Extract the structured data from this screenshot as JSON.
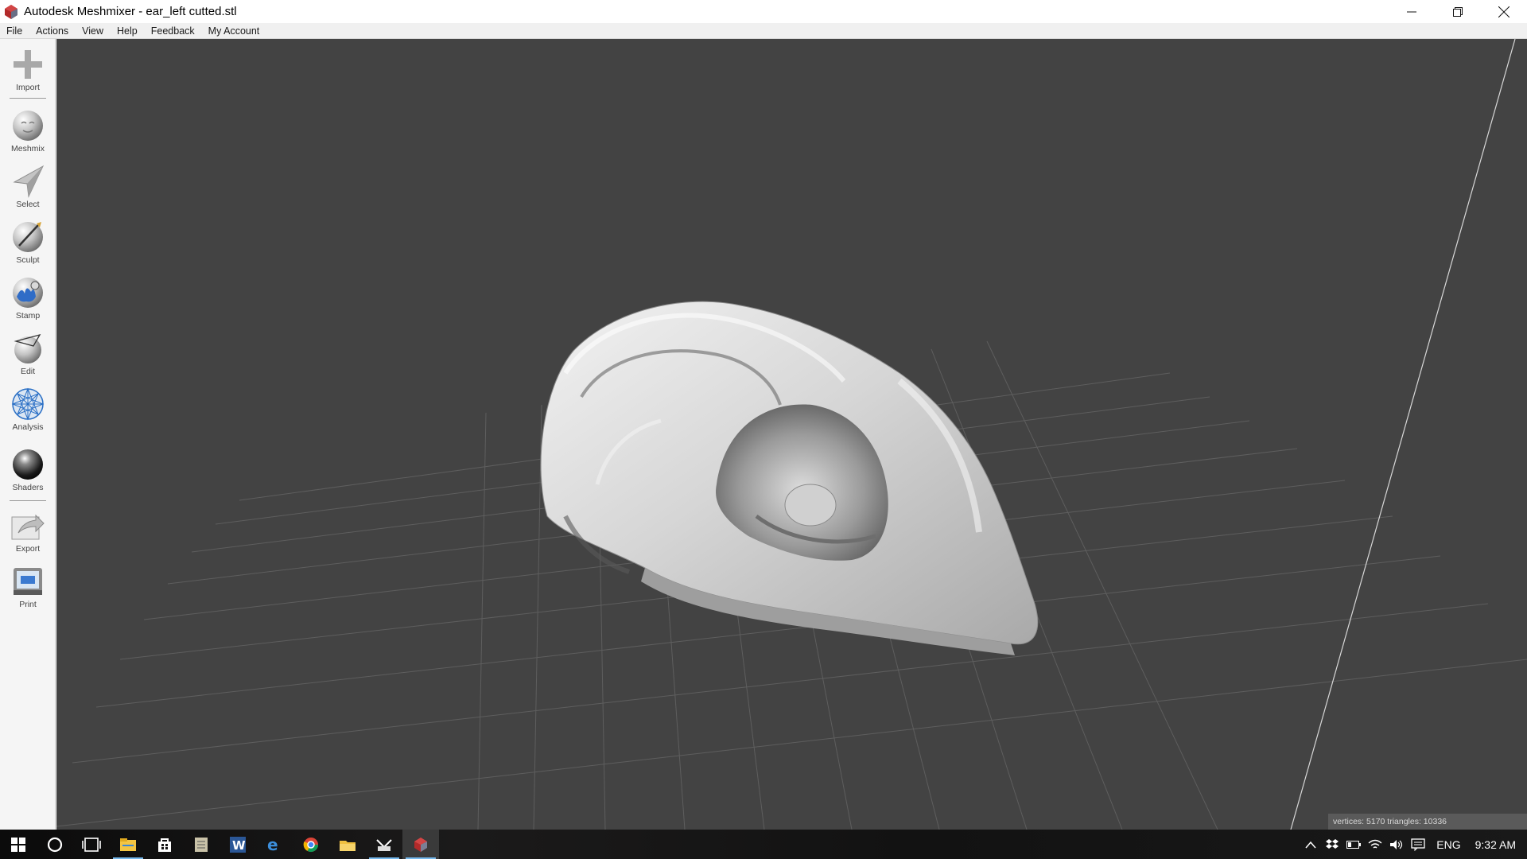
{
  "window": {
    "title": "Autodesk Meshmixer - ear_left cutted.stl"
  },
  "menu": {
    "items": [
      "File",
      "Actions",
      "View",
      "Help",
      "Feedback",
      "My Account"
    ]
  },
  "toolbar": {
    "tools": [
      {
        "label": "Import",
        "icon": "plus-icon"
      },
      {
        "label": "Meshmix",
        "icon": "meshmix-sphere-icon"
      },
      {
        "label": "Select",
        "icon": "select-arrow-icon"
      },
      {
        "label": "Sculpt",
        "icon": "sculpt-brush-icon"
      },
      {
        "label": "Stamp",
        "icon": "stamp-icon"
      },
      {
        "label": "Edit",
        "icon": "edit-sphere-icon"
      },
      {
        "label": "Analysis",
        "icon": "analysis-sphere-icon"
      },
      {
        "label": "Shaders",
        "icon": "shader-ball-icon"
      },
      {
        "label": "Export",
        "icon": "export-icon"
      },
      {
        "label": "Print",
        "icon": "printer-icon"
      }
    ]
  },
  "viewport": {
    "background": "#434343",
    "stats": "vertices: 5170 triangles: 10336"
  },
  "taskbar": {
    "apps": [
      "start-icon",
      "cortana-icon",
      "task-view-icon",
      "file-explorer-icon",
      "store-icon",
      "notepad-icon",
      "word-icon",
      "edge-icon",
      "chrome-icon",
      "folder-icon",
      "snipping-icon",
      "meshmixer-icon"
    ],
    "language": "ENG",
    "time": "9:32 AM"
  }
}
